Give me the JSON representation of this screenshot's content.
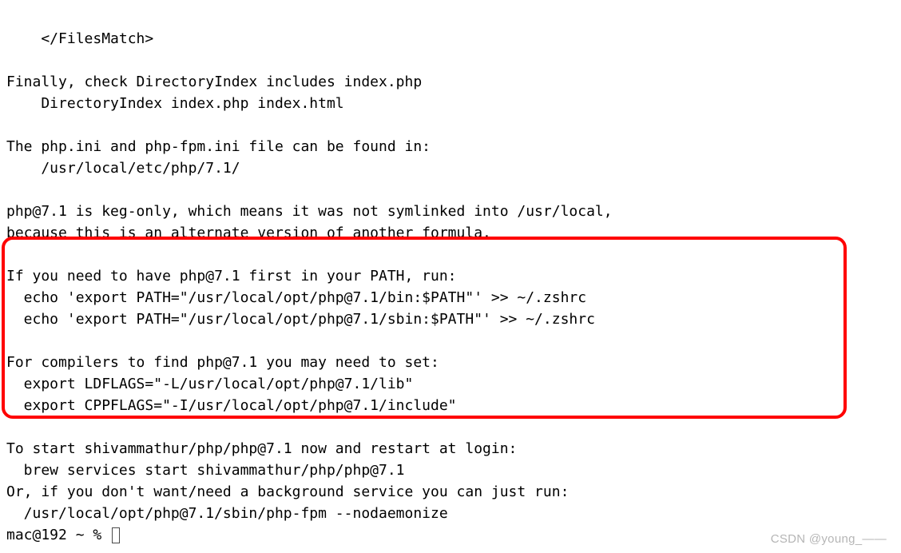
{
  "terminal": {
    "line1": "    </FilesMatch>",
    "line2": "",
    "line3": "Finally, check DirectoryIndex includes index.php",
    "line4": "    DirectoryIndex index.php index.html",
    "line5": "",
    "line6": "The php.ini and php-fpm.ini file can be found in:",
    "line7": "    /usr/local/etc/php/7.1/",
    "line8": "",
    "line9": "php@7.1 is keg-only, which means it was not symlinked into /usr/local,",
    "line10": "because this is an alternate version of another formula.",
    "line11": "",
    "line12": "If you need to have php@7.1 first in your PATH, run:",
    "line13": "  echo 'export PATH=\"/usr/local/opt/php@7.1/bin:$PATH\"' >> ~/.zshrc",
    "line14": "  echo 'export PATH=\"/usr/local/opt/php@7.1/sbin:$PATH\"' >> ~/.zshrc",
    "line15": "",
    "line16": "For compilers to find php@7.1 you may need to set:",
    "line17": "  export LDFLAGS=\"-L/usr/local/opt/php@7.1/lib\"",
    "line18": "  export CPPFLAGS=\"-I/usr/local/opt/php@7.1/include\"",
    "line19": "",
    "line20": "To start shivammathur/php/php@7.1 now and restart at login:",
    "line21": "  brew services start shivammathur/php/php@7.1",
    "line22": "Or, if you don't want/need a background service you can just run:",
    "line23": "  /usr/local/opt/php@7.1/sbin/php-fpm --nodaemonize",
    "prompt": "mac@192 ~ % "
  },
  "watermark": "CSDN @young_——"
}
